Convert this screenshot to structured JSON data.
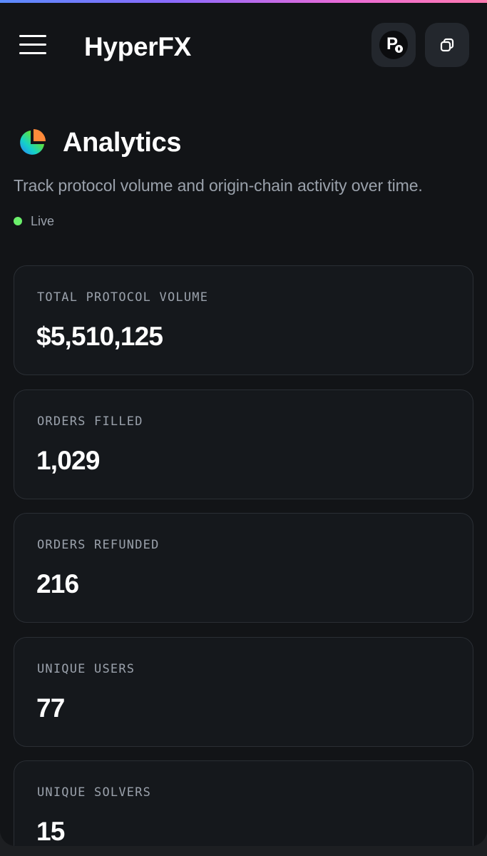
{
  "header": {
    "brand": "HyperFX",
    "avatar_letter": "P",
    "icons": {
      "menu": "hamburger-menu-icon",
      "avatar": "wallet-avatar",
      "copy": "copy-icon"
    }
  },
  "page": {
    "title": "Analytics",
    "title_icon": "pie-chart-icon",
    "subtitle": "Track protocol volume and origin-chain activity over time.",
    "status": "Live",
    "status_color": "#6bef6b"
  },
  "stats": [
    {
      "label": "TOTAL PROTOCOL VOLUME",
      "value": "$5,510,125"
    },
    {
      "label": "ORDERS FILLED",
      "value": "1,029"
    },
    {
      "label": "ORDERS REFUNDED",
      "value": "216"
    },
    {
      "label": "UNIQUE USERS",
      "value": "77"
    },
    {
      "label": "UNIQUE SOLVERS",
      "value": "15"
    }
  ],
  "colors": {
    "background": "#121417",
    "card_border": "#2a2e34",
    "muted_text": "#9aa1ab",
    "button_bg": "#23272d"
  }
}
